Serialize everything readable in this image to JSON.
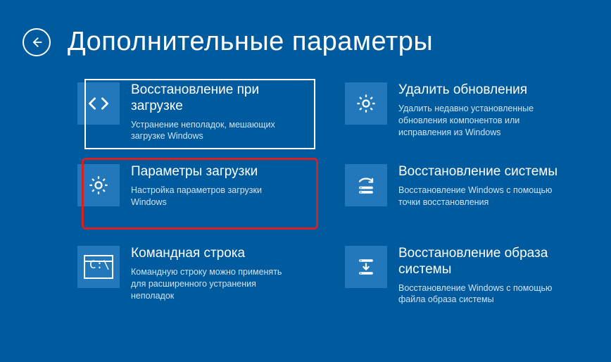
{
  "header": {
    "title": "Дополнительные параметры"
  },
  "tiles": {
    "startup_repair": {
      "title": "Восстановление при загрузке",
      "desc": "Устранение неполадок, мешающих загрузке Windows"
    },
    "uninstall_updates": {
      "title": "Удалить обновления",
      "desc": "Удалить недавно установленные обновления компонентов или исправления из Windows"
    },
    "startup_settings": {
      "title": "Параметры загрузки",
      "desc": "Настройка параметров загрузки Windows"
    },
    "system_restore": {
      "title": "Восстановление системы",
      "desc": "Восстановление Windows с помощью точки восстановления"
    },
    "command_prompt": {
      "title": "Командная строка",
      "desc": "Командную строку можно применять для расширенного устранения неполадок"
    },
    "system_image": {
      "title": "Восстановление образа системы",
      "desc": "Восстановление Windows с помощью файла образа системы"
    }
  }
}
